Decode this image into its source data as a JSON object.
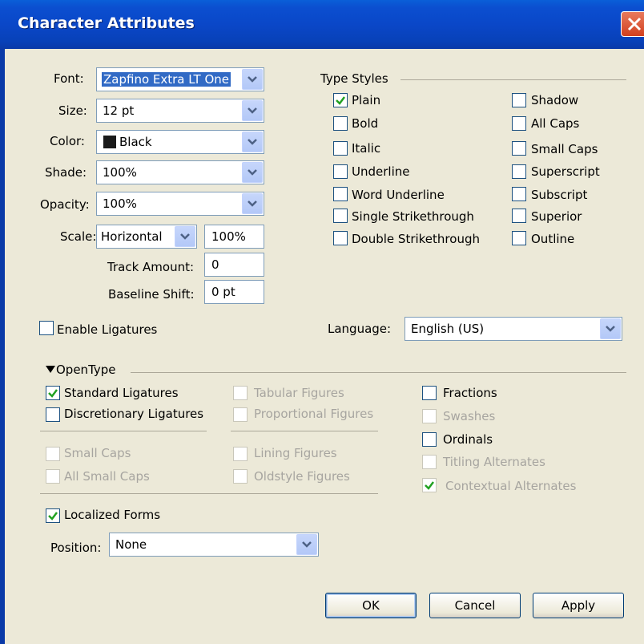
{
  "window": {
    "title": "Character Attributes"
  },
  "attributes": {
    "font_label": "Font:",
    "font_value": "Zapfino Extra LT One",
    "size_label": "Size:",
    "size_value": "12 pt",
    "color_label": "Color:",
    "color_value": "Black",
    "color_swatch": "#1a1a1a",
    "shade_label": "Shade:",
    "shade_value": "100%",
    "opacity_label": "Opacity:",
    "opacity_value": "100%",
    "scale_label": "Scale:",
    "scale_value": "Horizontal",
    "scale_amount": "100%",
    "track_label": "Track Amount:",
    "track_value": "0",
    "baseline_label": "Baseline Shift:",
    "baseline_value": "0 pt"
  },
  "type_styles": {
    "heading": "Type Styles",
    "left": [
      {
        "label": "Plain",
        "checked": true
      },
      {
        "label": "Bold",
        "checked": false
      },
      {
        "label": "Italic",
        "checked": false
      },
      {
        "label": "Underline",
        "checked": false
      },
      {
        "label": "Word Underline",
        "checked": false
      },
      {
        "label": "Single Strikethrough",
        "checked": false
      },
      {
        "label": "Double Strikethrough",
        "checked": false
      }
    ],
    "right": [
      {
        "label": "Shadow",
        "checked": false
      },
      {
        "label": "All Caps",
        "checked": false
      },
      {
        "label": "Small Caps",
        "checked": false
      },
      {
        "label": "Superscript",
        "checked": false
      },
      {
        "label": "Subscript",
        "checked": false
      },
      {
        "label": "Superior",
        "checked": false
      },
      {
        "label": "Outline",
        "checked": false
      }
    ]
  },
  "ligatures": {
    "label": "Enable Ligatures",
    "checked": false
  },
  "language": {
    "label": "Language:",
    "value": "English (US)"
  },
  "opentype": {
    "heading": "OpenType",
    "col1": [
      {
        "label": "Standard Ligatures",
        "checked": true,
        "enabled": true
      },
      {
        "label": "Discretionary Ligatures",
        "checked": false,
        "enabled": true
      },
      {
        "label": "Small Caps",
        "checked": false,
        "enabled": false
      },
      {
        "label": "All Small Caps",
        "checked": false,
        "enabled": false
      }
    ],
    "col2": [
      {
        "label": "Tabular Figures",
        "checked": false,
        "enabled": false
      },
      {
        "label": "Proportional Figures",
        "checked": false,
        "enabled": false
      },
      {
        "label": "Lining Figures",
        "checked": false,
        "enabled": false
      },
      {
        "label": "Oldstyle Figures",
        "checked": false,
        "enabled": false
      }
    ],
    "col3": [
      {
        "label": "Fractions",
        "checked": false,
        "enabled": true
      },
      {
        "label": "Swashes",
        "checked": false,
        "enabled": false
      },
      {
        "label": "Ordinals",
        "checked": false,
        "enabled": true
      },
      {
        "label": "Titling Alternates",
        "checked": false,
        "enabled": false
      },
      {
        "label": "Contextual Alternates",
        "checked": true,
        "enabled": false
      }
    ],
    "localized_forms": {
      "label": "Localized Forms",
      "checked": true
    },
    "position_label": "Position:",
    "position_value": "None"
  },
  "buttons": {
    "ok": "OK",
    "cancel": "Cancel",
    "apply": "Apply"
  },
  "colors": {
    "check_green": "#21a121",
    "title_blue": "#0a47c8",
    "dialog_bg": "#ece9d8"
  }
}
